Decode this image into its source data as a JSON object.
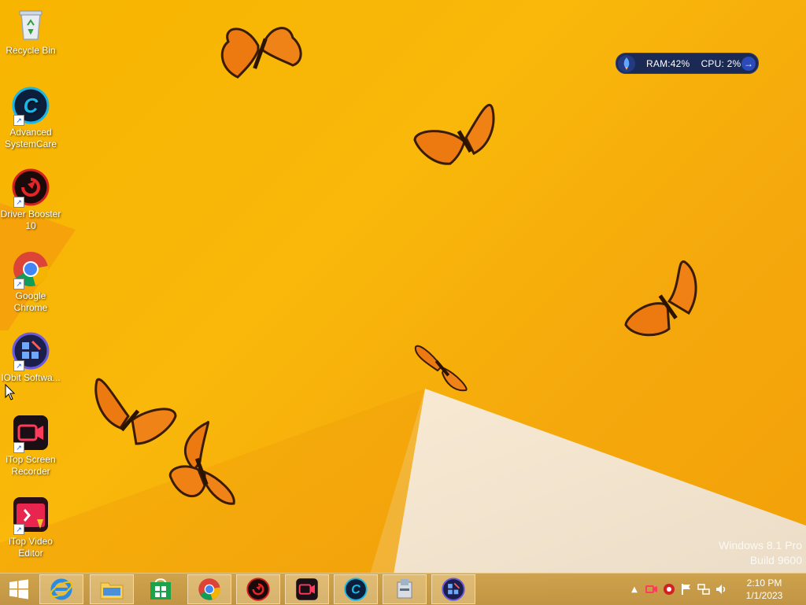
{
  "desktop_icons": [
    {
      "label": "Recycle Bin",
      "icon": "recycle-bin-icon"
    },
    {
      "label": "Advanced SystemCare",
      "icon": "advanced-systemcare-icon"
    },
    {
      "label": "Driver Booster 10",
      "icon": "driver-booster-icon"
    },
    {
      "label": "Google Chrome",
      "icon": "chrome-icon"
    },
    {
      "label": "IObit Softwa...",
      "icon": "iobit-software-icon"
    },
    {
      "label": "iTop Screen Recorder",
      "icon": "itop-screen-recorder-icon"
    },
    {
      "label": "iTop Video Editor",
      "icon": "itop-video-editor-icon"
    }
  ],
  "system_widget": {
    "ram_label": "RAM:42%",
    "cpu_label": "CPU: 2%",
    "ram_percent": 42,
    "cpu_percent": 2
  },
  "watermark": {
    "line1": "Windows 8.1 Pro",
    "line2": "Build 9600"
  },
  "taskbar": {
    "start": "start-button",
    "pinned": [
      {
        "name": "internet-explorer",
        "icon": "internet-explorer-icon"
      },
      {
        "name": "file-explorer",
        "icon": "file-explorer-icon"
      },
      {
        "name": "store",
        "icon": "store-icon"
      },
      {
        "name": "chrome",
        "icon": "chrome-icon"
      },
      {
        "name": "driver-booster",
        "icon": "driver-booster-icon"
      },
      {
        "name": "itop-screen-recorder",
        "icon": "itop-screen-recorder-icon"
      },
      {
        "name": "advanced-systemcare",
        "icon": "advanced-systemcare-icon"
      },
      {
        "name": "installer",
        "icon": "installer-icon"
      },
      {
        "name": "iobit-software",
        "icon": "iobit-software-icon"
      }
    ],
    "tray_icons": [
      "show-hidden-icon",
      "itop-recorder-tray-icon",
      "driver-booster-tray-icon",
      "action-center-flag-icon",
      "network-icon",
      "volume-icon"
    ],
    "clock": {
      "time": "2:10 PM",
      "date": "1/1/2023"
    }
  },
  "colors": {
    "wallpaper": "#f7b500",
    "taskbar": "#c9a050",
    "widget_bg": "#1b2a55"
  }
}
